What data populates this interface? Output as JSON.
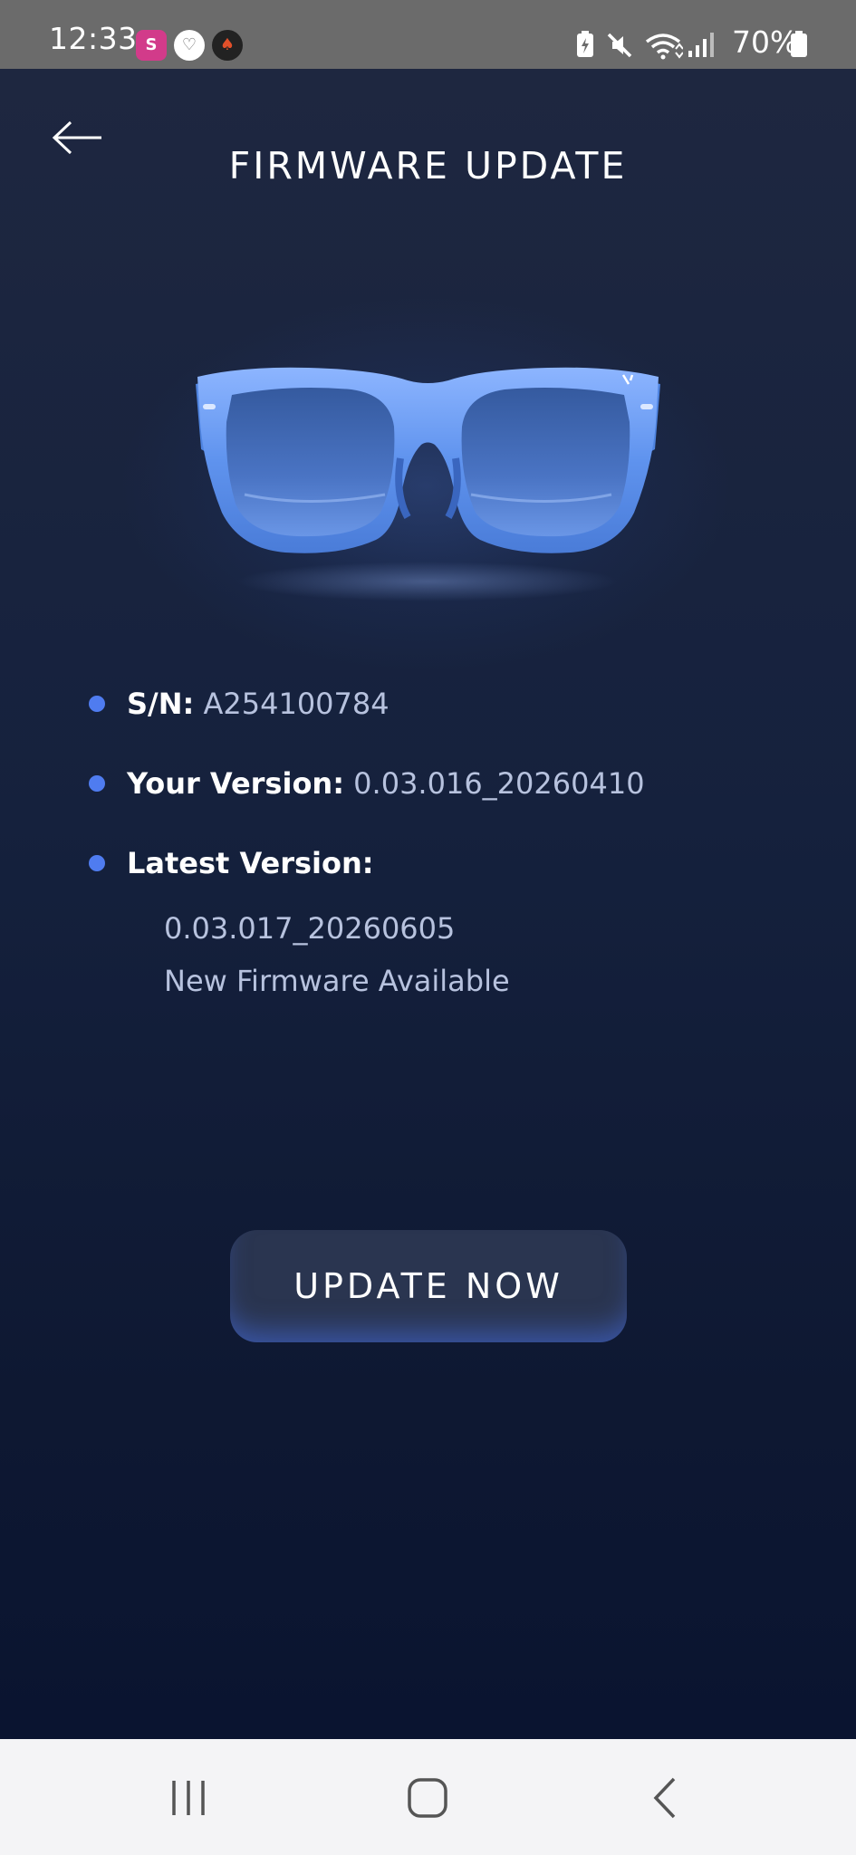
{
  "status_bar": {
    "time": "12:33",
    "battery_percent": "70%",
    "icons": [
      "app-notification-icon",
      "app-notification-icon",
      "app-notification-icon",
      "battery-saver-icon",
      "mute-icon",
      "wifi-icon",
      "signal-icon",
      "battery-icon"
    ]
  },
  "header": {
    "title": "FIRMWARE UPDATE",
    "back_icon": "arrow-left-icon"
  },
  "device": {
    "image": "smart-glasses"
  },
  "info": {
    "sn_label": "S/N:",
    "sn_value": "A254100784",
    "your_version_label": "Your Version:",
    "your_version_value": "0.03.016_20260410",
    "latest_version_label": "Latest Version:",
    "latest_version_value": "0.03.017_20260605",
    "status_text": "New Firmware Available"
  },
  "actions": {
    "update_label": "UPDATE NOW"
  },
  "nav_bar": {
    "icons": [
      "recent-apps-icon",
      "home-icon",
      "back-icon"
    ]
  },
  "colors": {
    "background_top": "#1e2740",
    "background_bottom": "#0a1430",
    "accent_blue": "#4f7cf0",
    "glasses_blue": "#6a9bf0",
    "muted_text": "#b7c2de"
  }
}
